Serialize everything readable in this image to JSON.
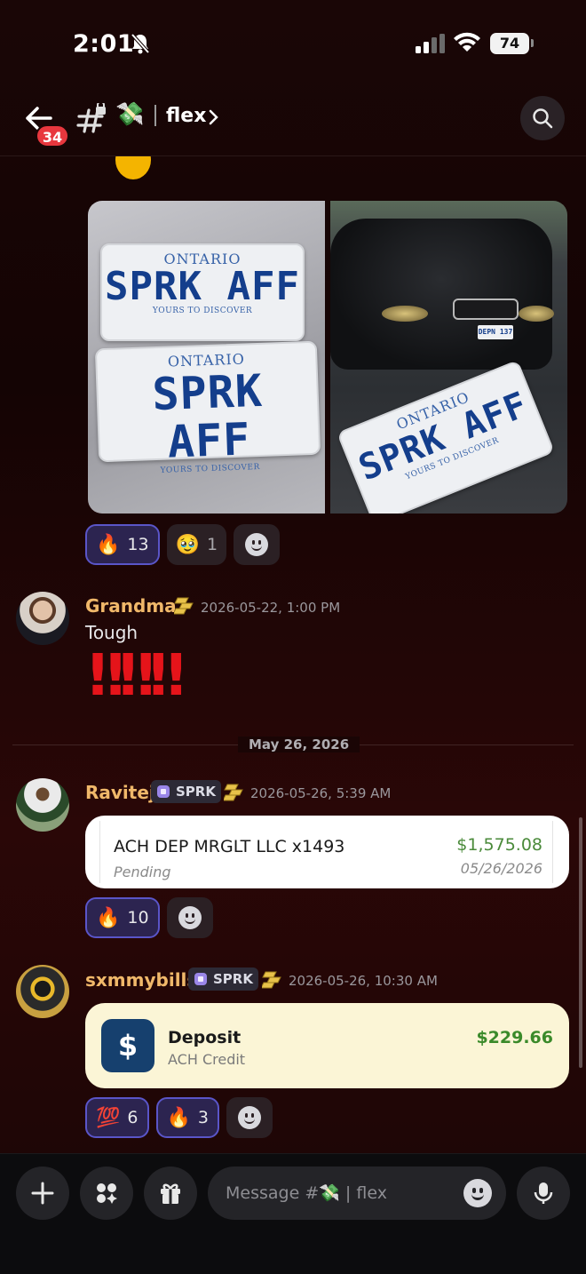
{
  "status_bar": {
    "time": "2:01",
    "battery": "74"
  },
  "header": {
    "back_badge": "34",
    "channel_emoji": "💸",
    "channel_name": "flex"
  },
  "message1": {
    "images": [
      {
        "plate_province": "ONTARIO",
        "plate_number": "SPRK AFF",
        "plate_slogan": "YOURS TO DISCOVER"
      },
      {
        "plate_province": "ONTARIO",
        "plate_number": "SPRK AFF",
        "plate_slogan": "YOURS TO DISCOVER",
        "small_plate": "DEPN 137"
      }
    ],
    "reactions": [
      {
        "emoji": "🔥",
        "count": "13",
        "active": true
      },
      {
        "emoji": "🥹",
        "count": "1",
        "active": false
      }
    ]
  },
  "message2": {
    "username": "Grandma",
    "timestamp": "2026-05-22, 1:00 PM",
    "text": "Tough",
    "emoji_text": "‼‼‼"
  },
  "date_divider": "May 26, 2026",
  "message3": {
    "username": "Ravitej",
    "tag": "SPRK",
    "timestamp": "2026-05-26, 5:39 AM",
    "card": {
      "title": "ACH DEP MRGLT LLC x1493",
      "status": "Pending",
      "amount": "$1,575.08",
      "date": "05/26/2026"
    },
    "reactions": [
      {
        "emoji": "🔥",
        "count": "10",
        "active": true
      }
    ]
  },
  "message4": {
    "username": "sxmmybills",
    "tag": "SPRK",
    "timestamp": "2026-05-26, 10:30 AM",
    "card": {
      "icon": "$",
      "title": "Deposit",
      "subtitle": "ACH Credit",
      "amount": "$229.66"
    },
    "reactions": [
      {
        "emoji": "💯",
        "count": "6",
        "active": true
      },
      {
        "emoji": "🔥",
        "count": "3",
        "active": true
      }
    ]
  },
  "composer": {
    "placeholder_prefix": "Message #",
    "placeholder_emoji": "💸",
    "placeholder_channel": "flex"
  },
  "colors": {
    "accent_username": "#f0b86a",
    "active_reaction_border": "#5a55c8",
    "positive_amount": "#3a8a2a",
    "badge_red": "#e8373e"
  }
}
